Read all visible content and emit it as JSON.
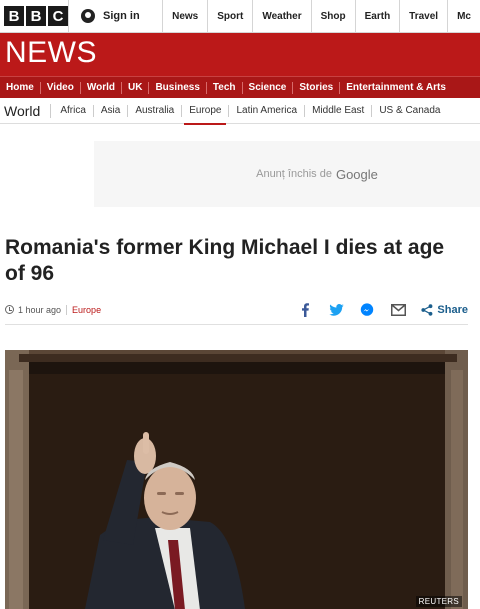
{
  "brand": {
    "letters": [
      "B",
      "B",
      "C"
    ]
  },
  "account": {
    "signin_label": "Sign in"
  },
  "top_nav": [
    "News",
    "Sport",
    "Weather",
    "Shop",
    "Earth",
    "Travel",
    "Mc"
  ],
  "news_banner": {
    "title": "NEWS"
  },
  "section_nav": [
    "Home",
    "Video",
    "World",
    "UK",
    "Business",
    "Tech",
    "Science",
    "Stories",
    "Entertainment & Arts"
  ],
  "sub_nav": {
    "title": "World",
    "items": [
      "Africa",
      "Asia",
      "Australia",
      "Europe",
      "Latin America",
      "Middle East",
      "US & Canada"
    ],
    "active": "Europe"
  },
  "ad": {
    "closed_text": "Anunț închis de",
    "provider": "Google"
  },
  "article": {
    "headline": "Romania's former King Michael I dies at age of 96",
    "timestamp": "1 hour ago",
    "section": "Europe",
    "share_label": "Share",
    "photo_credit": "REUTERS"
  },
  "share_icons": [
    "facebook-icon",
    "twitter-icon",
    "messenger-icon",
    "email-icon",
    "share-icon"
  ],
  "colors": {
    "bbc_red": "#bb1919",
    "section_red": "#a91717",
    "share_blue": "#1b5e8c"
  }
}
